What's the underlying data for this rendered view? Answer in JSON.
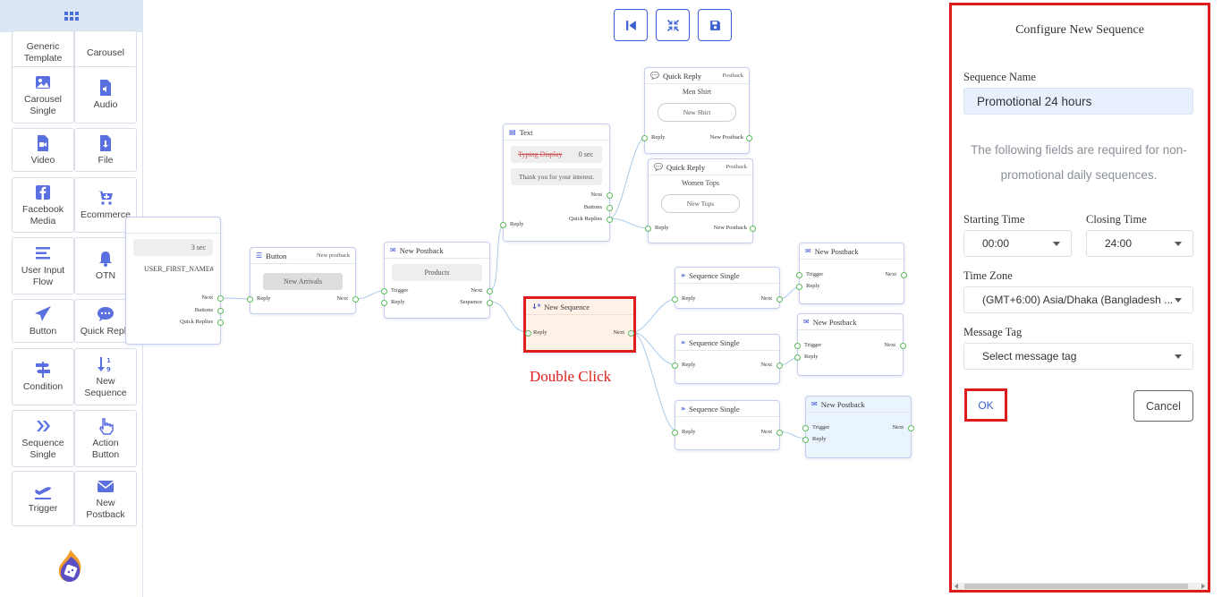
{
  "sidebar": {
    "tiles": [
      {
        "label": "Generic\nTemplate",
        "icon": "generic-template-icon"
      },
      {
        "label": "Carousel",
        "icon": "carousel-icon"
      },
      {
        "label": "Carousel\nSingle",
        "icon": "image-icon"
      },
      {
        "label": "Audio",
        "icon": "audio-file-icon"
      },
      {
        "label": "Video",
        "icon": "video-file-icon"
      },
      {
        "label": "File",
        "icon": "file-download-icon"
      },
      {
        "label": "Facebook\nMedia",
        "icon": "facebook-icon"
      },
      {
        "label": "Ecommerce",
        "icon": "cart-plus-icon"
      },
      {
        "label": "User Input\nFlow",
        "icon": "list-icon"
      },
      {
        "label": "OTN",
        "icon": "bell-icon"
      },
      {
        "label": "Button",
        "icon": "paper-plane-icon"
      },
      {
        "label": "Quick Reply",
        "icon": "chat-bubble-icon"
      },
      {
        "label": "Condition",
        "icon": "signpost-icon"
      },
      {
        "label": "New\nSequence",
        "icon": "sort-numeric-icon"
      },
      {
        "label": "Sequence\nSingle",
        "icon": "double-chevron-icon"
      },
      {
        "label": "Action\nButton",
        "icon": "hand-pointer-icon"
      },
      {
        "label": "Trigger",
        "icon": "plane-departure-icon"
      },
      {
        "label": "New\nPostback",
        "icon": "envelope-icon"
      }
    ]
  },
  "canvas": {
    "partial_node": {
      "delay": "3 sec",
      "text": "USER_FIRST_NAME#",
      "ports": [
        "Next",
        "Buttons",
        "Quick Replies"
      ]
    },
    "button_node": {
      "title": "Button",
      "sub": "New postback",
      "pill": "New Arrivals",
      "in": "Reply",
      "out": "Next"
    },
    "postback_node": {
      "title": "New Postback",
      "pill": "Products",
      "in1": "Trigger",
      "in2": "Reply",
      "out1": "Next",
      "out2": "Sequence"
    },
    "text_node": {
      "title": "Text",
      "typing": "Typing Display",
      "delay": "0 sec",
      "message": "Thank you for your interest.",
      "in": "Reply",
      "out1": "Next",
      "out2": "Buttons",
      "out3": "Quick Replies"
    },
    "qr1": {
      "title": "Quick Reply",
      "sub": "Postback",
      "label": "Men Shirt",
      "button": "New Shirt",
      "in": "Reply",
      "out": "New Postback"
    },
    "qr2": {
      "title": "Quick Reply",
      "sub": "Postback",
      "label": "Women Tops",
      "button": "New Tops",
      "in": "Reply",
      "out": "New Postback"
    },
    "sequence_node": {
      "title": "New Sequence",
      "in": "Reply",
      "out": "Next"
    },
    "seq_single": [
      {
        "title": "Sequence Single",
        "in": "Reply",
        "out": "Next"
      },
      {
        "title": "Sequence Single",
        "in": "Reply",
        "out": "Next"
      },
      {
        "title": "Sequence Single",
        "in": "Reply",
        "out": "Next"
      }
    ],
    "end_postbacks": [
      {
        "title": "New Postback",
        "in1": "Trigger",
        "in2": "Reply",
        "out": "Next"
      },
      {
        "title": "New Postback",
        "in1": "Trigger",
        "in2": "Reply",
        "out": "Next"
      },
      {
        "title": "New Postback",
        "in1": "Trigger",
        "in2": "Reply",
        "out": "Next"
      }
    ],
    "annotation": "Double Click"
  },
  "panel": {
    "title": "Configure New Sequence",
    "sequence_name_label": "Sequence Name",
    "sequence_name_value": "Promotional 24 hours",
    "note": "The following fields are required for non-promotional daily sequences.",
    "starting_time_label": "Starting Time",
    "starting_time_value": "00:00",
    "closing_time_label": "Closing Time",
    "closing_time_value": "24:00",
    "timezone_label": "Time Zone",
    "timezone_value": "(GMT+6:00) Asia/Dhaka (Bangladesh ...",
    "message_tag_label": "Message Tag",
    "message_tag_value": "Select message tag",
    "ok": "OK",
    "cancel": "Cancel"
  },
  "colors": {
    "accent": "#3a5fd0",
    "highlight": "#e01b1b",
    "port": "#5cb85c"
  }
}
